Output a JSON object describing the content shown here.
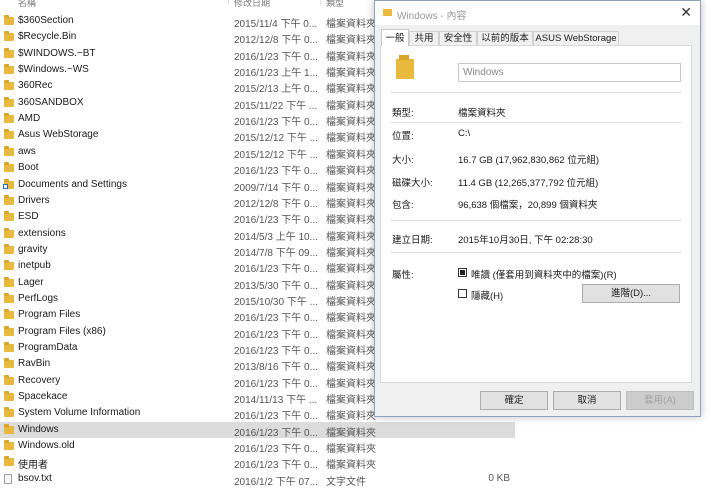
{
  "explorer": {
    "headers": {
      "name": "名稱",
      "date": "修改日期",
      "type": "類型",
      "size": "大小"
    },
    "rows": [
      {
        "name": "$360Section",
        "date": "2015/11/4 下午 0...",
        "type": "檔案資料夾",
        "icon": "folder-icon"
      },
      {
        "name": "$Recycle.Bin",
        "date": "2012/12/8 下午 0...",
        "type": "檔案資料夾",
        "icon": "folder-icon"
      },
      {
        "name": "$WINDOWS.~BT",
        "date": "2016/1/23 下午 0...",
        "type": "檔案資料夾",
        "icon": "folder-icon"
      },
      {
        "name": "$Windows.~WS",
        "date": "2016/1/23 上午 1...",
        "type": "檔案資料夾",
        "icon": "folder-icon"
      },
      {
        "name": "360Rec",
        "date": "2015/2/13 上午 0...",
        "type": "檔案資料夾",
        "icon": "folder-icon"
      },
      {
        "name": "360SANDBOX",
        "date": "2015/11/22 下午 ...",
        "type": "檔案資料夾",
        "icon": "folder-icon"
      },
      {
        "name": "AMD",
        "date": "2016/1/23 下午 0...",
        "type": "檔案資料夾",
        "icon": "folder-icon"
      },
      {
        "name": "Asus WebStorage",
        "date": "2015/12/12 下午 ...",
        "type": "檔案資料夾",
        "icon": "folder-icon"
      },
      {
        "name": "aws",
        "date": "2015/12/12 下午 ...",
        "type": "檔案資料夾",
        "icon": "folder-icon"
      },
      {
        "name": "Boot",
        "date": "2016/1/23 下午 0...",
        "type": "檔案資料夾",
        "icon": "folder-icon"
      },
      {
        "name": "Documents and Settings",
        "date": "2009/7/14 下午 0...",
        "type": "檔案資料夾",
        "icon": "shortcut-folder-icon"
      },
      {
        "name": "Drivers",
        "date": "2012/12/8 下午 0...",
        "type": "檔案資料夾",
        "icon": "folder-icon"
      },
      {
        "name": "ESD",
        "date": "2016/1/23 下午 0...",
        "type": "檔案資料夾",
        "icon": "folder-icon"
      },
      {
        "name": "extensions",
        "date": "2014/5/3 上午 10...",
        "type": "檔案資料夾",
        "icon": "folder-icon"
      },
      {
        "name": "gravity",
        "date": "2014/7/8 下午 09...",
        "type": "檔案資料夾",
        "icon": "folder-icon"
      },
      {
        "name": "inetpub",
        "date": "2016/1/23 下午 0...",
        "type": "檔案資料夾",
        "icon": "folder-icon"
      },
      {
        "name": "Lager",
        "date": "2013/5/30 下午 0...",
        "type": "檔案資料夾",
        "icon": "folder-icon"
      },
      {
        "name": "PerfLogs",
        "date": "2015/10/30 下午 ...",
        "type": "檔案資料夾",
        "icon": "folder-icon"
      },
      {
        "name": "Program Files",
        "date": "2016/1/23 下午 0...",
        "type": "檔案資料夾",
        "icon": "folder-icon"
      },
      {
        "name": "Program Files (x86)",
        "date": "2016/1/23 下午 0...",
        "type": "檔案資料夾",
        "icon": "folder-icon"
      },
      {
        "name": "ProgramData",
        "date": "2016/1/23 下午 0...",
        "type": "檔案資料夾",
        "icon": "folder-icon"
      },
      {
        "name": "RavBin",
        "date": "2013/8/16 下午 0...",
        "type": "檔案資料夾",
        "icon": "folder-icon"
      },
      {
        "name": "Recovery",
        "date": "2016/1/23 下午 0...",
        "type": "檔案資料夾",
        "icon": "folder-icon"
      },
      {
        "name": "Spacekace",
        "date": "2014/11/13 下午 ...",
        "type": "檔案資料夾",
        "icon": "folder-icon"
      },
      {
        "name": "System Volume Information",
        "date": "2016/1/23 下午 0...",
        "type": "檔案資料夾",
        "icon": "folder-icon"
      },
      {
        "name": "Windows",
        "date": "2016/1/23 下午 0...",
        "type": "檔案資料夾",
        "icon": "folder-icon",
        "selected": true
      },
      {
        "name": "Windows.old",
        "date": "2016/1/23 下午 0...",
        "type": "檔案資料夾",
        "icon": "folder-icon"
      },
      {
        "name": "使用者",
        "date": "2016/1/23 下午 0...",
        "type": "檔案資料夾",
        "icon": "folder-icon"
      },
      {
        "name": "bsov.txt",
        "date": "2016/1/2 下午 07...",
        "type": "文字文件",
        "size": "0 KB",
        "icon": "text-file-icon"
      }
    ]
  },
  "dialog": {
    "title": "Windows - 內容",
    "tabs": [
      "一般",
      "共用",
      "安全性",
      "以前的版本",
      "ASUS WebStorage"
    ],
    "name_value": "Windows",
    "props": {
      "type_label": "類型:",
      "type_value": "檔案資料夾",
      "location_label": "位置:",
      "location_value": "C:\\",
      "size_label": "大小:",
      "size_value": "16.7 GB (17,962,830,862 位元組)",
      "disk_size_label": "磁碟大小:",
      "disk_size_value": "11.4 GB (12,265,377,792 位元組)",
      "contains_label": "包含:",
      "contains_value": "96,638 個檔案，20,899 個資料夾",
      "created_label": "建立日期:",
      "created_value": "2015年10月30日, 下午 02:28:30",
      "attributes_label": "屬性:",
      "readonly_label": "唯讀 (僅套用到資料夾中的檔案)(R)",
      "hidden_label": "隱藏(H)",
      "advanced_label": "進階(D)..."
    },
    "buttons": {
      "ok": "確定",
      "cancel": "取消",
      "apply": "套用(A)"
    }
  }
}
